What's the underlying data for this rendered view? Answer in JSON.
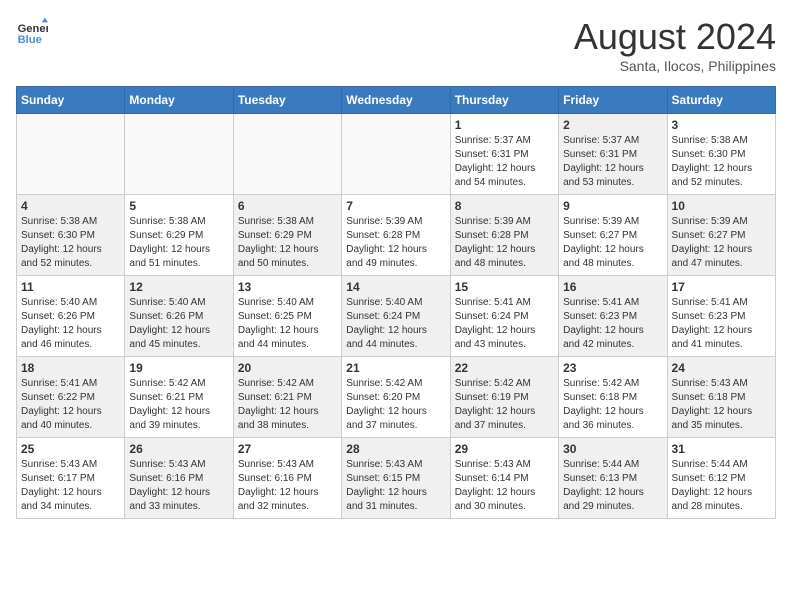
{
  "header": {
    "logo_line1": "General",
    "logo_line2": "Blue",
    "title": "August 2024",
    "subtitle": "Santa, Ilocos, Philippines"
  },
  "weekdays": [
    "Sunday",
    "Monday",
    "Tuesday",
    "Wednesday",
    "Thursday",
    "Friday",
    "Saturday"
  ],
  "weeks": [
    [
      {
        "day": "",
        "info": "",
        "empty": true
      },
      {
        "day": "",
        "info": "",
        "empty": true
      },
      {
        "day": "",
        "info": "",
        "empty": true
      },
      {
        "day": "",
        "info": "",
        "empty": true
      },
      {
        "day": "1",
        "info": "Sunrise: 5:37 AM\nSunset: 6:31 PM\nDaylight: 12 hours\nand 54 minutes."
      },
      {
        "day": "2",
        "info": "Sunrise: 5:37 AM\nSunset: 6:31 PM\nDaylight: 12 hours\nand 53 minutes.",
        "shaded": true
      },
      {
        "day": "3",
        "info": "Sunrise: 5:38 AM\nSunset: 6:30 PM\nDaylight: 12 hours\nand 52 minutes."
      }
    ],
    [
      {
        "day": "4",
        "info": "Sunrise: 5:38 AM\nSunset: 6:30 PM\nDaylight: 12 hours\nand 52 minutes.",
        "shaded": true
      },
      {
        "day": "5",
        "info": "Sunrise: 5:38 AM\nSunset: 6:29 PM\nDaylight: 12 hours\nand 51 minutes."
      },
      {
        "day": "6",
        "info": "Sunrise: 5:38 AM\nSunset: 6:29 PM\nDaylight: 12 hours\nand 50 minutes.",
        "shaded": true
      },
      {
        "day": "7",
        "info": "Sunrise: 5:39 AM\nSunset: 6:28 PM\nDaylight: 12 hours\nand 49 minutes."
      },
      {
        "day": "8",
        "info": "Sunrise: 5:39 AM\nSunset: 6:28 PM\nDaylight: 12 hours\nand 48 minutes.",
        "shaded": true
      },
      {
        "day": "9",
        "info": "Sunrise: 5:39 AM\nSunset: 6:27 PM\nDaylight: 12 hours\nand 48 minutes."
      },
      {
        "day": "10",
        "info": "Sunrise: 5:39 AM\nSunset: 6:27 PM\nDaylight: 12 hours\nand 47 minutes.",
        "shaded": true
      }
    ],
    [
      {
        "day": "11",
        "info": "Sunrise: 5:40 AM\nSunset: 6:26 PM\nDaylight: 12 hours\nand 46 minutes."
      },
      {
        "day": "12",
        "info": "Sunrise: 5:40 AM\nSunset: 6:26 PM\nDaylight: 12 hours\nand 45 minutes.",
        "shaded": true
      },
      {
        "day": "13",
        "info": "Sunrise: 5:40 AM\nSunset: 6:25 PM\nDaylight: 12 hours\nand 44 minutes."
      },
      {
        "day": "14",
        "info": "Sunrise: 5:40 AM\nSunset: 6:24 PM\nDaylight: 12 hours\nand 44 minutes.",
        "shaded": true
      },
      {
        "day": "15",
        "info": "Sunrise: 5:41 AM\nSunset: 6:24 PM\nDaylight: 12 hours\nand 43 minutes."
      },
      {
        "day": "16",
        "info": "Sunrise: 5:41 AM\nSunset: 6:23 PM\nDaylight: 12 hours\nand 42 minutes.",
        "shaded": true
      },
      {
        "day": "17",
        "info": "Sunrise: 5:41 AM\nSunset: 6:23 PM\nDaylight: 12 hours\nand 41 minutes."
      }
    ],
    [
      {
        "day": "18",
        "info": "Sunrise: 5:41 AM\nSunset: 6:22 PM\nDaylight: 12 hours\nand 40 minutes.",
        "shaded": true
      },
      {
        "day": "19",
        "info": "Sunrise: 5:42 AM\nSunset: 6:21 PM\nDaylight: 12 hours\nand 39 minutes."
      },
      {
        "day": "20",
        "info": "Sunrise: 5:42 AM\nSunset: 6:21 PM\nDaylight: 12 hours\nand 38 minutes.",
        "shaded": true
      },
      {
        "day": "21",
        "info": "Sunrise: 5:42 AM\nSunset: 6:20 PM\nDaylight: 12 hours\nand 37 minutes."
      },
      {
        "day": "22",
        "info": "Sunrise: 5:42 AM\nSunset: 6:19 PM\nDaylight: 12 hours\nand 37 minutes.",
        "shaded": true
      },
      {
        "day": "23",
        "info": "Sunrise: 5:42 AM\nSunset: 6:18 PM\nDaylight: 12 hours\nand 36 minutes."
      },
      {
        "day": "24",
        "info": "Sunrise: 5:43 AM\nSunset: 6:18 PM\nDaylight: 12 hours\nand 35 minutes.",
        "shaded": true
      }
    ],
    [
      {
        "day": "25",
        "info": "Sunrise: 5:43 AM\nSunset: 6:17 PM\nDaylight: 12 hours\nand 34 minutes."
      },
      {
        "day": "26",
        "info": "Sunrise: 5:43 AM\nSunset: 6:16 PM\nDaylight: 12 hours\nand 33 minutes.",
        "shaded": true
      },
      {
        "day": "27",
        "info": "Sunrise: 5:43 AM\nSunset: 6:16 PM\nDaylight: 12 hours\nand 32 minutes."
      },
      {
        "day": "28",
        "info": "Sunrise: 5:43 AM\nSunset: 6:15 PM\nDaylight: 12 hours\nand 31 minutes.",
        "shaded": true
      },
      {
        "day": "29",
        "info": "Sunrise: 5:43 AM\nSunset: 6:14 PM\nDaylight: 12 hours\nand 30 minutes."
      },
      {
        "day": "30",
        "info": "Sunrise: 5:44 AM\nSunset: 6:13 PM\nDaylight: 12 hours\nand 29 minutes.",
        "shaded": true
      },
      {
        "day": "31",
        "info": "Sunrise: 5:44 AM\nSunset: 6:12 PM\nDaylight: 12 hours\nand 28 minutes."
      }
    ]
  ]
}
